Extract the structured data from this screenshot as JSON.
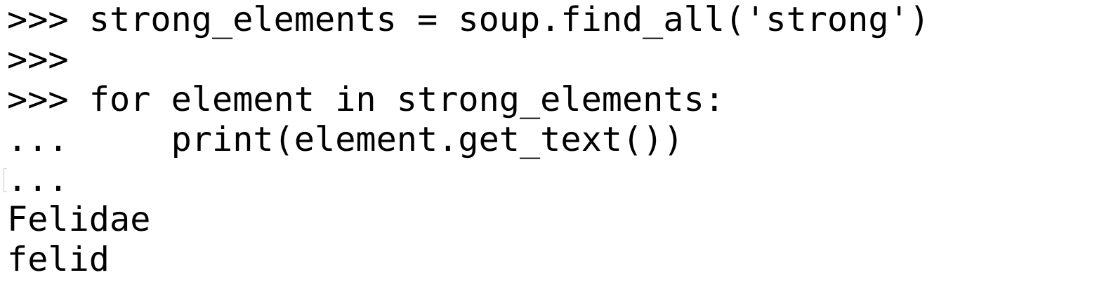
{
  "terminal": {
    "lines": [
      ">>> strong_elements = soup.find_all('strong')",
      ">>>",
      ">>> for element in strong_elements:",
      "...     print(element.get_text())",
      "...",
      "Felidae",
      "felid"
    ]
  }
}
